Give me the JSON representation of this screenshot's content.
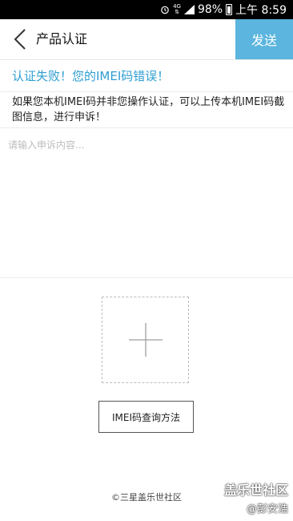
{
  "status_bar": {
    "lte": "4G",
    "battery": "98%",
    "time": "上午 8:59"
  },
  "header": {
    "title": "产品认证",
    "send_label": "发送"
  },
  "error_message": "认证失败！您的IMEI码错误！",
  "description": "如果您本机IMEI码并非您操作认证，可以上传本机IMEI码截图信息，进行申诉！",
  "appeal_input": {
    "placeholder": "请输入申诉内容...",
    "value": ""
  },
  "imei_method_button": "IMEI码查询方法",
  "footer": "©三星盖乐世社区",
  "watermark": {
    "title": "盖乐世社区",
    "user": "@彭安浩"
  },
  "colors": {
    "accent": "#5bb5de",
    "error_text": "#2e9ed2"
  }
}
